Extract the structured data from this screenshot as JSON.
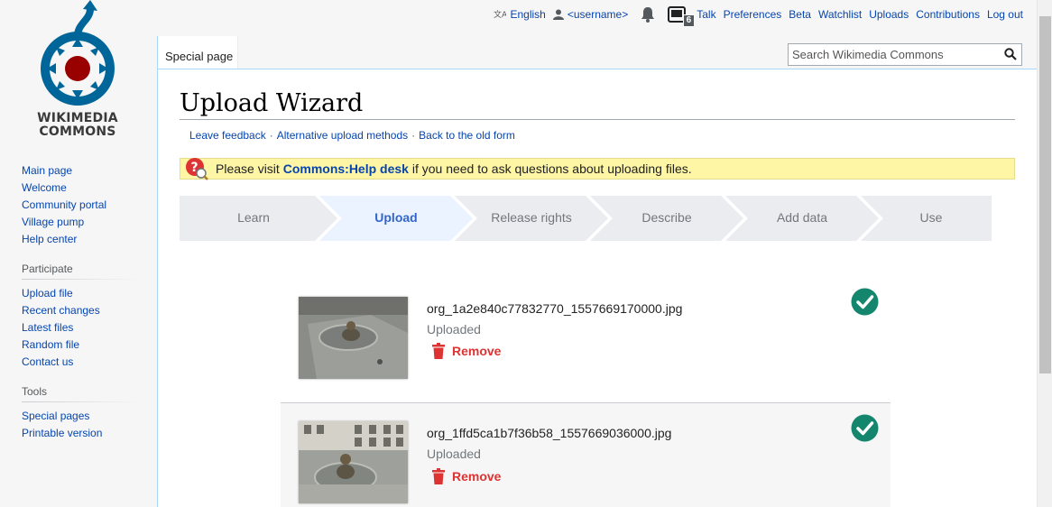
{
  "logo": {
    "line1": "WIKIMEDIA",
    "line2": "COMMONS"
  },
  "personal": {
    "language": "English",
    "username": "<username>",
    "notice_count": "6",
    "links": [
      "Talk",
      "Preferences",
      "Beta",
      "Watchlist",
      "Uploads",
      "Contributions",
      "Log out"
    ]
  },
  "tabs": {
    "special": "Special page"
  },
  "search": {
    "placeholder": "Search Wikimedia Commons"
  },
  "sidebar": {
    "main": [
      "Main page",
      "Welcome",
      "Community portal",
      "Village pump",
      "Help center"
    ],
    "participate_heading": "Participate",
    "participate": [
      "Upload file",
      "Recent changes",
      "Latest files",
      "Random file",
      "Contact us"
    ],
    "tools_heading": "Tools",
    "tools": [
      "Special pages",
      "Printable version"
    ]
  },
  "page": {
    "title": "Upload Wizard",
    "links": [
      "Leave feedback",
      "Alternative upload methods",
      "Back to the old form"
    ],
    "help_prefix": "Please visit ",
    "help_link": "Commons:Help desk",
    "help_suffix": " if you need to ask questions about uploading files."
  },
  "steps": [
    "Learn",
    "Upload",
    "Release rights",
    "Describe",
    "Add data",
    "Use"
  ],
  "active_step": "Upload",
  "uploads": [
    {
      "filename": "org_1a2e840c77832770_1557669170000.jpg",
      "status": "Uploaded",
      "remove_label": "Remove"
    },
    {
      "filename": "org_1ffd5ca1b7f36b58_1557669036000.jpg",
      "status": "Uploaded",
      "remove_label": "Remove"
    }
  ],
  "colors": {
    "link": "#0645ad",
    "active_step": "#3366cc",
    "remove": "#d33",
    "success": "#14866d",
    "helpbox": "#fef6a5"
  }
}
